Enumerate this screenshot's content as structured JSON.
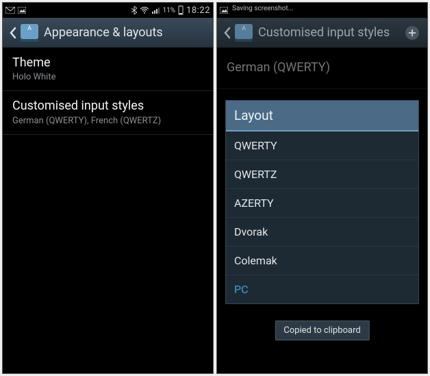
{
  "left": {
    "status": {
      "bluetooth": "bluetooth-icon",
      "wifi": "wifi-icon",
      "signal": "signal-icon",
      "battery_pct": "11%",
      "battery": "battery-icon",
      "clock": "18:22"
    },
    "action_bar": {
      "title": "Appearance & layouts"
    },
    "items": [
      {
        "title": "Theme",
        "subtitle": "Holo White"
      },
      {
        "title": "Customised input styles",
        "subtitle": "German (QWERTY), French (QWERTZ)"
      }
    ]
  },
  "right": {
    "status": {
      "saving_text": "Saving screenshot..."
    },
    "action_bar": {
      "title": "Customised input styles"
    },
    "heading": "German (QWERTY)",
    "dialog": {
      "title": "Layout",
      "options": [
        {
          "label": "QWERTY",
          "accent": false
        },
        {
          "label": "QWERTZ",
          "accent": false
        },
        {
          "label": "AZERTY",
          "accent": false
        },
        {
          "label": "Dvorak",
          "accent": false
        },
        {
          "label": "Colemak",
          "accent": false
        },
        {
          "label": "PC",
          "accent": true
        }
      ]
    },
    "toast": "Copied to clipboard"
  }
}
